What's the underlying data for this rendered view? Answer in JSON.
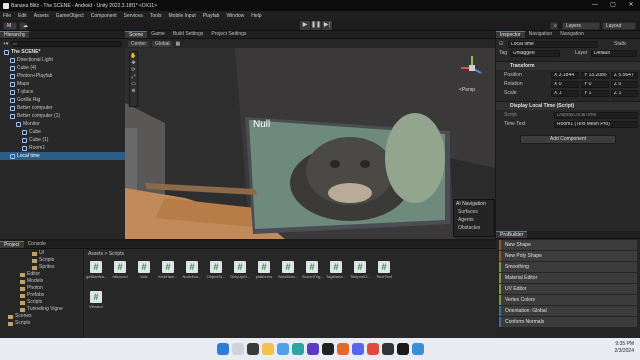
{
  "window": {
    "title": "Banana Blitz - The SCENE - Android - Unity 2022.3.18f1* <DX11>",
    "controls": [
      "—",
      "▢",
      "✕"
    ]
  },
  "menu": [
    "File",
    "Edit",
    "Assets",
    "GameObject",
    "Component",
    "Services",
    "Tools",
    "Mobile Input",
    "Playfab",
    "Window",
    "Help"
  ],
  "toolbar": {
    "account": "M",
    "layers": "Layers",
    "layout": "Layout"
  },
  "hierarchy": {
    "tab": "Hierarchy",
    "search_placeholder": "All",
    "items": [
      {
        "label": "The SCENE*",
        "indent": 0,
        "kind": "scene"
      },
      {
        "label": "Directional Light",
        "indent": 2,
        "kind": "obj"
      },
      {
        "label": "Cube (4)",
        "indent": 2,
        "kind": "obj"
      },
      {
        "label": "Photon+Playfab",
        "indent": 2,
        "kind": "obj"
      },
      {
        "label": "Maps",
        "indent": 2,
        "kind": "obj"
      },
      {
        "label": "T-place",
        "indent": 2,
        "kind": "obj"
      },
      {
        "label": "Gorilla Rig",
        "indent": 2,
        "kind": "obj"
      },
      {
        "label": "Better computer",
        "indent": 2,
        "kind": "obj"
      },
      {
        "label": "Better computer (1)",
        "indent": 2,
        "kind": "obj"
      },
      {
        "label": "Monitor",
        "indent": 4,
        "kind": "obj"
      },
      {
        "label": "Cube",
        "indent": 6,
        "kind": "obj"
      },
      {
        "label": "Cube (1)",
        "indent": 6,
        "kind": "obj"
      },
      {
        "label": "Room1",
        "indent": 6,
        "kind": "obj"
      },
      {
        "label": "Local time",
        "indent": 2,
        "kind": "sel"
      }
    ]
  },
  "scene": {
    "tabs": [
      "Scene",
      "Game",
      "Build Settings",
      "Project Settings"
    ],
    "center": "Center",
    "global": "Global",
    "persp": "<Persp",
    "null_text": "Null",
    "ai_nav": {
      "title": "AI Navigation",
      "items": [
        "Surfaces",
        "Agents",
        "Obstacles"
      ]
    }
  },
  "inspector": {
    "tabs": [
      "Inspector",
      "Navigation",
      "Navigation"
    ],
    "object_name": "Local time",
    "static": "Static",
    "tag_label": "Tag",
    "tag_value": "Untagged",
    "layer_label": "Layer",
    "layer_value": "Default",
    "transform": {
      "title": "Transform",
      "position_label": "Position",
      "rotation_label": "Rotation",
      "scale_label": "Scale",
      "position": [
        "X 3.1844",
        "Y 13.2085",
        "Z 5.5647"
      ],
      "rotation": [
        "X 0",
        "Y 0",
        "Z 0"
      ],
      "scale": [
        "X 1",
        "Y 1",
        "Z 1"
      ]
    },
    "script_component": {
      "title": "Display Local Time (Script)",
      "script_label": "Script",
      "script_value": "DisplayLocalTime",
      "time_text_label": "Time Text",
      "time_text_value": "Room1 (Text Mesh Pro)"
    },
    "add_component": "Add Component"
  },
  "probuilder": {
    "tab": "ProBuilder",
    "buttons": [
      {
        "label": "New Shape",
        "color": "#8b5e3c"
      },
      {
        "label": "New Poly Shape",
        "color": "#8b5e3c"
      },
      {
        "label": "Smoothing",
        "color": "#7a9a3c"
      },
      {
        "label": "Material Editor",
        "color": "#7a9a3c"
      },
      {
        "label": "UV Editor",
        "color": "#7a9a3c"
      },
      {
        "label": "Vertex Colors",
        "color": "#7a9a3c"
      },
      {
        "label": "Orientation: Global",
        "color": "#3c6e9a"
      },
      {
        "label": "Conform Normals",
        "color": "#3c6e9a"
      }
    ]
  },
  "project": {
    "tabs": [
      "Project",
      "Console"
    ],
    "breadcrumb": "Assets > Scripts",
    "tree": [
      {
        "label": "UI",
        "indent": 8
      },
      {
        "label": "Scripts",
        "indent": 8
      },
      {
        "label": "Sprites",
        "indent": 8
      },
      {
        "label": "Editor",
        "indent": 5
      },
      {
        "label": "Models",
        "indent": 5
      },
      {
        "label": "Photon",
        "indent": 5
      },
      {
        "label": "Prefabs",
        "indent": 5
      },
      {
        "label": "Scripts",
        "indent": 5
      },
      {
        "label": "Tunneling Vigne",
        "indent": 5
      },
      {
        "label": "Scenes",
        "indent": 2
      },
      {
        "label": "Scripts",
        "indent": 2
      }
    ],
    "assets": [
      "getBanNa...",
      "hitsound",
      "lock",
      "KickHam...",
      "NoAdmo...",
      "ObjectSt...",
      "OnlyUpM...",
      "platforms",
      "SaveMan...",
      "SoundTrig...",
      "TagMana...",
      "TeleportO...",
      "TimeText",
      "Vibrator"
    ]
  },
  "taskbar": {
    "time": "9:35 PM",
    "date": "2/3/2024"
  }
}
